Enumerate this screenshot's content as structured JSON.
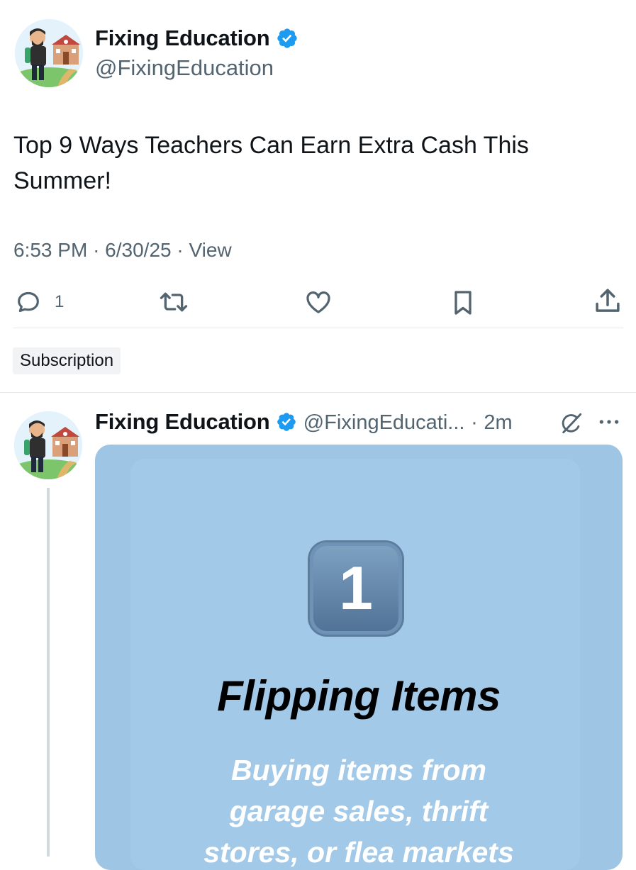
{
  "main_tweet": {
    "author_name": "Fixing Education",
    "author_handle": "@FixingEducation",
    "text": "Top 9 Ways Teachers Can Earn Extra Cash This Summer!",
    "time": "6:53 PM",
    "date": "6/30/25",
    "view_label": "View",
    "separator": "·",
    "reply_count": "1"
  },
  "subscription_label": "Subscription",
  "reply_tweet": {
    "author_name": "Fixing Education",
    "author_handle": "@FixingEducati...",
    "separator": "·",
    "time_ago": "2m",
    "media": {
      "number": "1",
      "title": "Flipping Items",
      "body_lines": [
        "Buying items from",
        "garage sales, thrift",
        "stores, or flea markets"
      ]
    }
  },
  "colors": {
    "verified_badge": "#1d9bf0",
    "secondary_text": "#536471",
    "media_background": "#9ec5e4"
  },
  "icons": [
    "reply-icon",
    "retweet-icon",
    "like-icon",
    "bookmark-icon",
    "share-icon",
    "verified-badge-icon",
    "grok-icon",
    "more-options-icon"
  ]
}
